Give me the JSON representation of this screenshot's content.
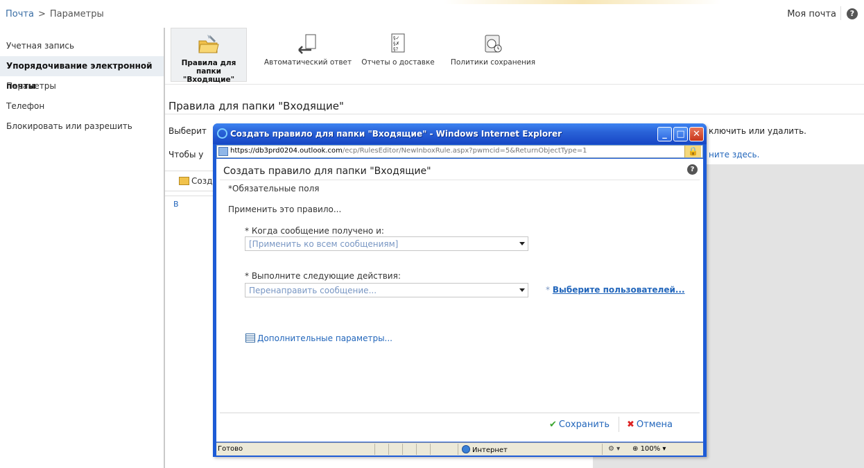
{
  "breadcrumb": {
    "root": "Почта",
    "separator": ">",
    "current": "Параметры"
  },
  "header": {
    "my_mail": "Моя почта",
    "help": "?"
  },
  "sidebar": {
    "items": [
      {
        "label": "Учетная запись"
      },
      {
        "label": "Упорядочивание электронной почты",
        "active": true
      },
      {
        "label": "Параметры"
      },
      {
        "label": "Телефон"
      },
      {
        "label": "Блокировать или разрешить"
      }
    ]
  },
  "ribbon": {
    "inbox_rules_line1": "Правила для",
    "inbox_rules_line2": "папки \"Входящие\"",
    "auto_reply": "Автоматический ответ",
    "delivery_reports": "Отчеты о доставке",
    "retention_policies": "Политики сохранения"
  },
  "content": {
    "title": "Правила для папки \"Входящие\"",
    "text1_prefix": "Выберит",
    "text1_suffix": "ключить или удалить.",
    "text2_prefix": "Чтобы у",
    "text2_suffix": "ните здесь.",
    "toolbar_create": "Созд",
    "list_col_b": "В"
  },
  "ie_window": {
    "title": "Создать правило для папки \"Входящие\" - Windows Internet Explorer",
    "url_prefix": "https://db3prd0204.",
    "url_domain": "outlook.com",
    "url_path": "/ecp/RulesEditor/NewInboxRule.aspx?pwmcid=5&ReturnObjectType=1",
    "status_ready": "Готово",
    "status_zone": "Интернет",
    "status_zoom": "100%"
  },
  "dialog": {
    "title": "Создать правило для папки \"Входящие\"",
    "help": "?",
    "required_note": "*Обязательные поля",
    "apply_label": "Применить это правило...",
    "when_label": "* Когда сообщение получено и:",
    "when_value": "[Применить ко всем сообщениям]",
    "do_label": "* Выполните следующие действия:",
    "do_value": "Перенаправить сообщение...",
    "pick_users_prefix": "*",
    "pick_users_link": "Выберите пользователей...",
    "more_options": "Дополнительные параметры...",
    "save": "Сохранить",
    "cancel": "Отмена"
  },
  "colors": {
    "link": "#2266bb",
    "ie_title": "#1d5bd6",
    "nav_active_bg": "#e9eef3"
  }
}
